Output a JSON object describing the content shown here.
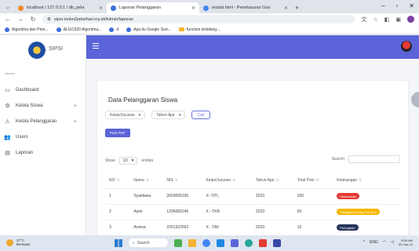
{
  "browser": {
    "tabs": [
      {
        "title": "localhost / 127.0.0.1 / db_pela",
        "favicon_color": "#f28b24",
        "active": false
      },
      {
        "title": "Laporan Pelanggaran",
        "favicon_color": "#3b6fd8",
        "active": true
      },
      {
        "title": "modal html - Penelusuran Goo",
        "favicon_color": "#4285f4",
        "active": false
      }
    ],
    "url": "sipsi-smkn2pelaihari.my.id/Admin/laporan",
    "bookmarks": [
      {
        "label": "Algoritma dan Pem...",
        "type": "site"
      },
      {
        "label": "ALGO320 Algoritma...",
        "type": "site"
      },
      {
        "label": "d",
        "type": "site"
      },
      {
        "label": "Apa itu Google Sort...",
        "type": "site"
      },
      {
        "label": "function terbilang...",
        "type": "folder"
      }
    ]
  },
  "sidebar": {
    "brand": "SIPSI",
    "section_label": "Navbar",
    "items": [
      {
        "label": "Dashboard",
        "icon": "monitor-icon",
        "glyph": "▭",
        "expandable": false
      },
      {
        "label": "Kelola Siswa",
        "icon": "users-cog-icon",
        "glyph": "⚙",
        "expandable": true
      },
      {
        "label": "Kelola Pelanggaran",
        "icon": "warning-icon",
        "glyph": "⚠",
        "expandable": true
      },
      {
        "label": "Users",
        "icon": "user-group-icon",
        "glyph": "👥",
        "expandable": false
      },
      {
        "label": "Laporan",
        "icon": "report-icon",
        "glyph": "▤",
        "expandable": false
      }
    ]
  },
  "colors": {
    "primary": "#5b64d8",
    "danger": "#e53935",
    "warning": "#f5b800",
    "dark": "#27345c"
  },
  "card": {
    "title": "Data Pelanggaran Siswa",
    "filter_class": "Kelas/Jurusan",
    "filter_year": "Tahun Ajar",
    "search_button": "Cari",
    "pdf_button": "Print PDF",
    "show_label": "Show",
    "entries_value": "10",
    "entries_label": "entries",
    "search_label": "Search:"
  },
  "table": {
    "headers": [
      "NO",
      "Nama",
      "NIS",
      "Kelas/Jurusan",
      "Tahun Ajar",
      "Total Poin",
      "Keterangan"
    ],
    "rows": [
      {
        "no": "1",
        "nama": "Syaidawa",
        "nis": "2603095236",
        "kelas": "X- TITL",
        "tahun": "2023",
        "poin": "100",
        "ket": "Dikeluarkan",
        "ket_color": "#e53935"
      },
      {
        "no": "2",
        "nama": "Azmi",
        "nis": "1206082245",
        "kelas": "X - TKR",
        "tahun": "2023",
        "poin": "60",
        "ket": "Panggilan Orang Tua ke-2",
        "ket_color": "#f5b800"
      },
      {
        "no": "3",
        "nama": "Annisa",
        "nis": "2201322562",
        "kelas": "X - TAV",
        "tahun": "2023",
        "poin": "10",
        "ket": "Peringatan",
        "ket_color": "#27345c"
      }
    ]
  },
  "taskbar": {
    "weather_temp": "27°C",
    "weather_text": "Berawan",
    "search_label": "Search",
    "tray_lang": "ENG",
    "time": "8:39 AM",
    "date": "09-Jan-24"
  }
}
